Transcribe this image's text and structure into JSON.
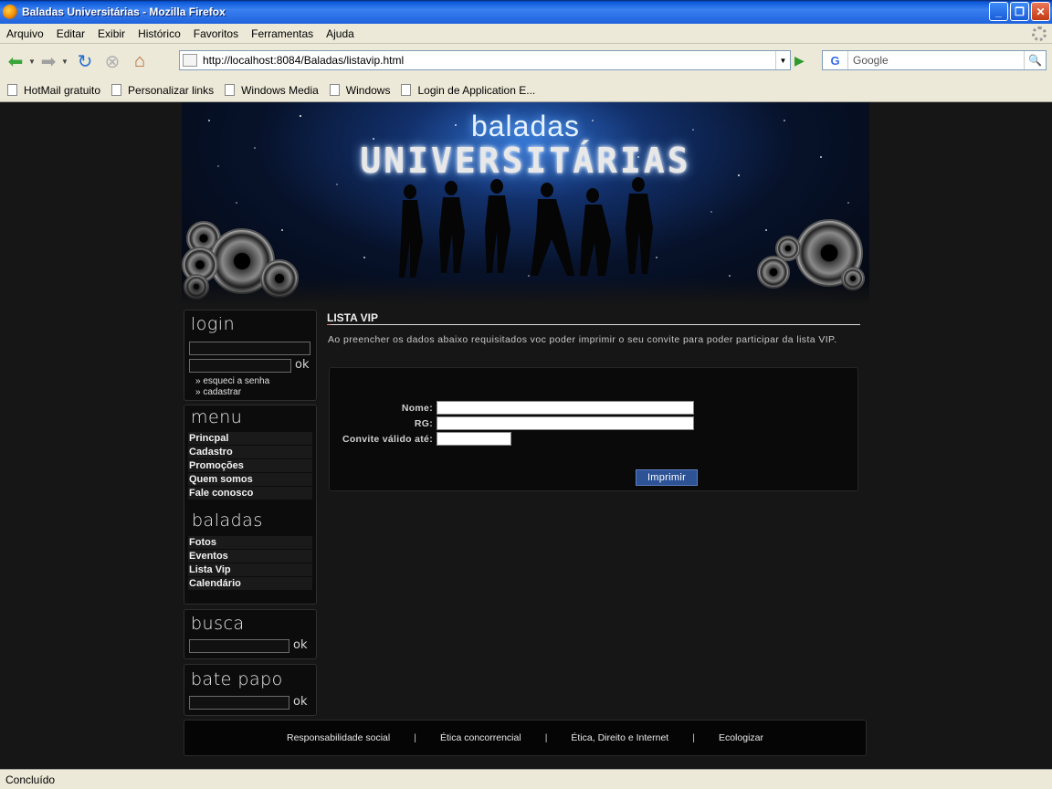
{
  "window": {
    "title": "Baladas Universitárias - Mozilla Firefox"
  },
  "menubar": {
    "items": [
      "Arquivo",
      "Editar",
      "Exibir",
      "Histórico",
      "Favoritos",
      "Ferramentas",
      "Ajuda"
    ]
  },
  "toolbar": {
    "url": "http://localhost:8084/Baladas/listavip.html",
    "search_engine_letter": "G",
    "search_placeholder": "Google"
  },
  "bookmarks": [
    "HotMail gratuito",
    "Personalizar links",
    "Windows Media",
    "Windows",
    "Login de Application E..."
  ],
  "site": {
    "brand_top": "baladas",
    "brand_main": "UNIVERSITÁRIAS",
    "login": {
      "title": "login",
      "ok": "ok",
      "forgot": "» esqueci a senha",
      "register": "» cadastrar"
    },
    "menu": {
      "title": "menu",
      "items": [
        "Princpal",
        "Cadastro",
        "Promoções",
        "Quem somos",
        "Fale conosco"
      ]
    },
    "baladas": {
      "title": "baladas",
      "items": [
        "Fotos",
        "Eventos",
        "Lista Vip",
        "Calendário"
      ]
    },
    "busca": {
      "title": "busca",
      "ok": "ok"
    },
    "chat": {
      "title": "bate papo",
      "ok": "ok"
    },
    "main": {
      "title": "LISTA VIP",
      "description": "Ao preencher os dados abaixo requisitados voc poder imprimir o seu convite para poder participar da lista VIP.",
      "form": {
        "name_label": "Nome:",
        "rg_label": "RG:",
        "valid_label": "Convite válido até:",
        "print_button": "Imprimir"
      }
    },
    "footer": {
      "links": [
        "Responsabilidade social",
        "Ética concorrencial",
        "Ética, Direito e Internet",
        "Ecologizar"
      ],
      "separator": "|"
    }
  },
  "status": {
    "text": "Concluído"
  }
}
